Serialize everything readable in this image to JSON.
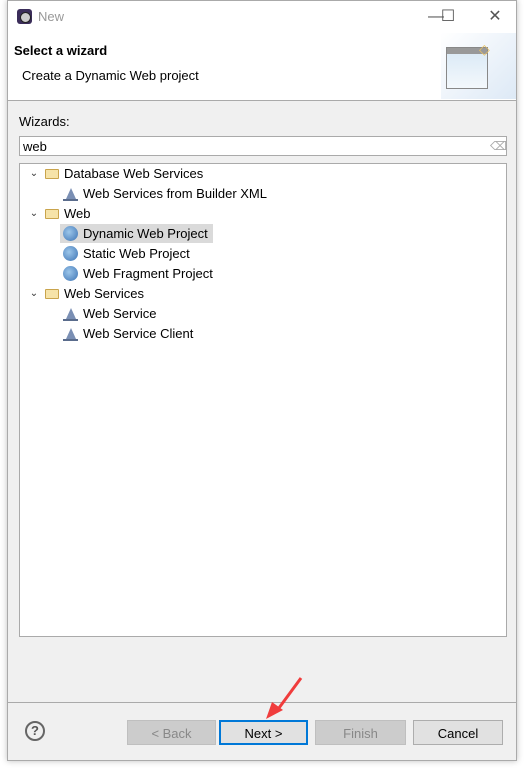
{
  "window": {
    "title": "New",
    "minimize": "—",
    "maximize": "☐",
    "close": "✕"
  },
  "header": {
    "title": "Select a wizard",
    "description": "Create a Dynamic Web project"
  },
  "wizards": {
    "label": "Wizards:",
    "filter_value": "web"
  },
  "tree": [
    {
      "label": "Database Web Services",
      "type": "folder",
      "expanded": true,
      "level": 0
    },
    {
      "label": "Web Services from Builder XML",
      "type": "web-service",
      "level": 1
    },
    {
      "label": "Web",
      "type": "folder",
      "expanded": true,
      "level": 0
    },
    {
      "label": "Dynamic Web Project",
      "type": "web-project",
      "level": 1,
      "selected": true
    },
    {
      "label": "Static Web Project",
      "type": "web-project",
      "level": 1
    },
    {
      "label": "Web Fragment Project",
      "type": "web-project",
      "level": 1
    },
    {
      "label": "Web Services",
      "type": "folder",
      "expanded": true,
      "level": 0
    },
    {
      "label": "Web Service",
      "type": "web-service",
      "level": 1
    },
    {
      "label": "Web Service Client",
      "type": "web-service",
      "level": 1
    }
  ],
  "buttons": {
    "help": "?",
    "back": "< Back",
    "next": "Next >",
    "finish": "Finish",
    "cancel": "Cancel"
  },
  "colors": {
    "default_button_border": "#0078d7",
    "annotation_arrow": "#f03c3c",
    "selection": "#dadada"
  }
}
